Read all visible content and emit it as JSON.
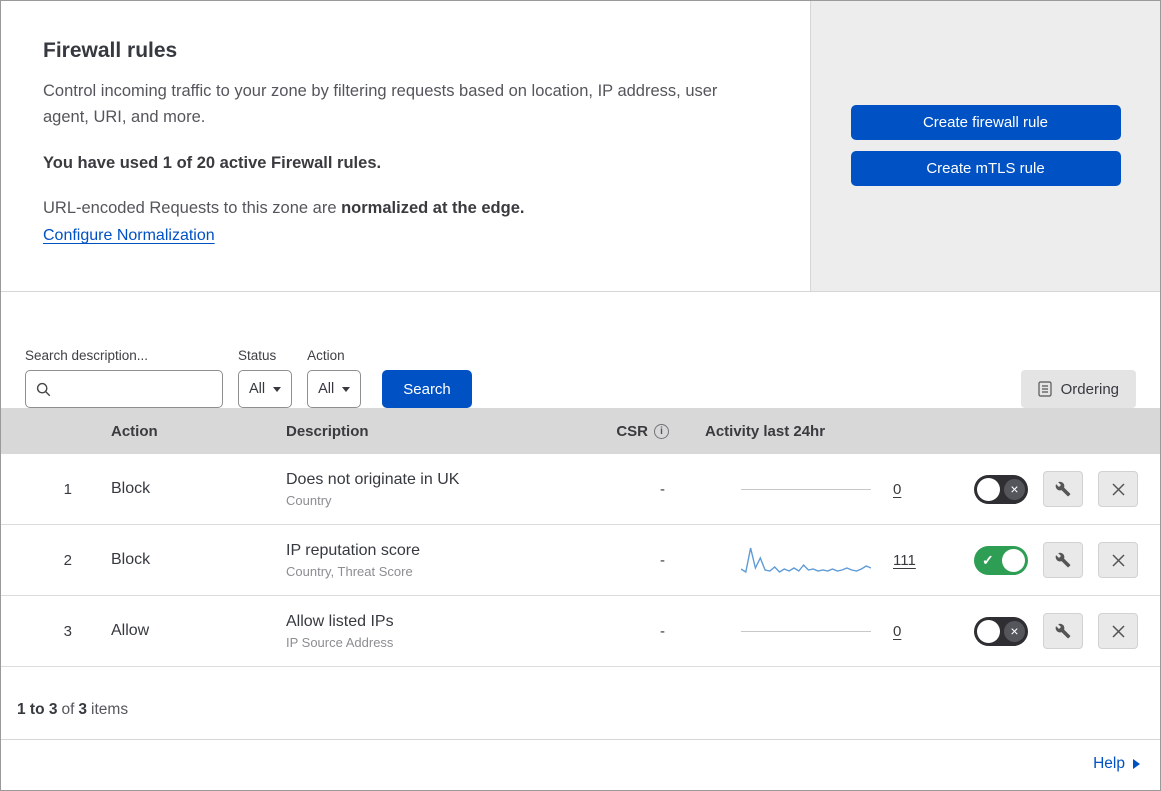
{
  "header": {
    "title": "Firewall rules",
    "description": "Control incoming traffic to your zone by filtering requests based on location, IP address, user agent, URI, and more.",
    "usage_text": "You have used 1 of 20 active Firewall rules.",
    "normalization_prefix": "URL-encoded Requests to this zone are ",
    "normalization_bold": "normalized at the edge.",
    "normalization_link": "Configure Normalization",
    "buttons": {
      "create_firewall": "Create firewall rule",
      "create_mtls": "Create mTLS rule"
    }
  },
  "filters": {
    "search_label": "Search description...",
    "search_value": "",
    "status_label": "Status",
    "status_value": "All",
    "action_label": "Action",
    "action_value": "All",
    "search_button": "Search",
    "ordering_button": "Ordering"
  },
  "table": {
    "headers": {
      "action": "Action",
      "description": "Description",
      "csr": "CSR",
      "activity": "Activity last 24hr"
    },
    "rows": [
      {
        "priority": "1",
        "action": "Block",
        "description": "Does not originate in UK",
        "criteria": "Country",
        "csr": "-",
        "activity_count": "0",
        "enabled": false,
        "sparkline": null
      },
      {
        "priority": "2",
        "action": "Block",
        "description": "IP reputation score",
        "criteria": "Country, Threat Score",
        "csr": "-",
        "activity_count": "111",
        "enabled": true,
        "sparkline": [
          6,
          3,
          27,
          7,
          17,
          5,
          4,
          8,
          3,
          6,
          4,
          7,
          4,
          10,
          5,
          6,
          4,
          5,
          4,
          6,
          4,
          5,
          7,
          5,
          4,
          6,
          9,
          7
        ]
      },
      {
        "priority": "3",
        "action": "Allow",
        "description": "Allow listed IPs",
        "criteria": "IP Source Address",
        "csr": "-",
        "activity_count": "0",
        "enabled": false,
        "sparkline": null
      }
    ]
  },
  "footer": {
    "range": "1 to 3",
    "of": "of",
    "total": "3",
    "items": "items"
  },
  "help": {
    "label": "Help"
  },
  "icons": {
    "info": "i",
    "check": "✓",
    "cross": "×"
  },
  "colors": {
    "primary_blue": "#0051c3",
    "toggle_on_green": "#2f9e55",
    "toggle_off_dark": "#2f2f33",
    "sparkline_blue": "#5f9bd6"
  }
}
